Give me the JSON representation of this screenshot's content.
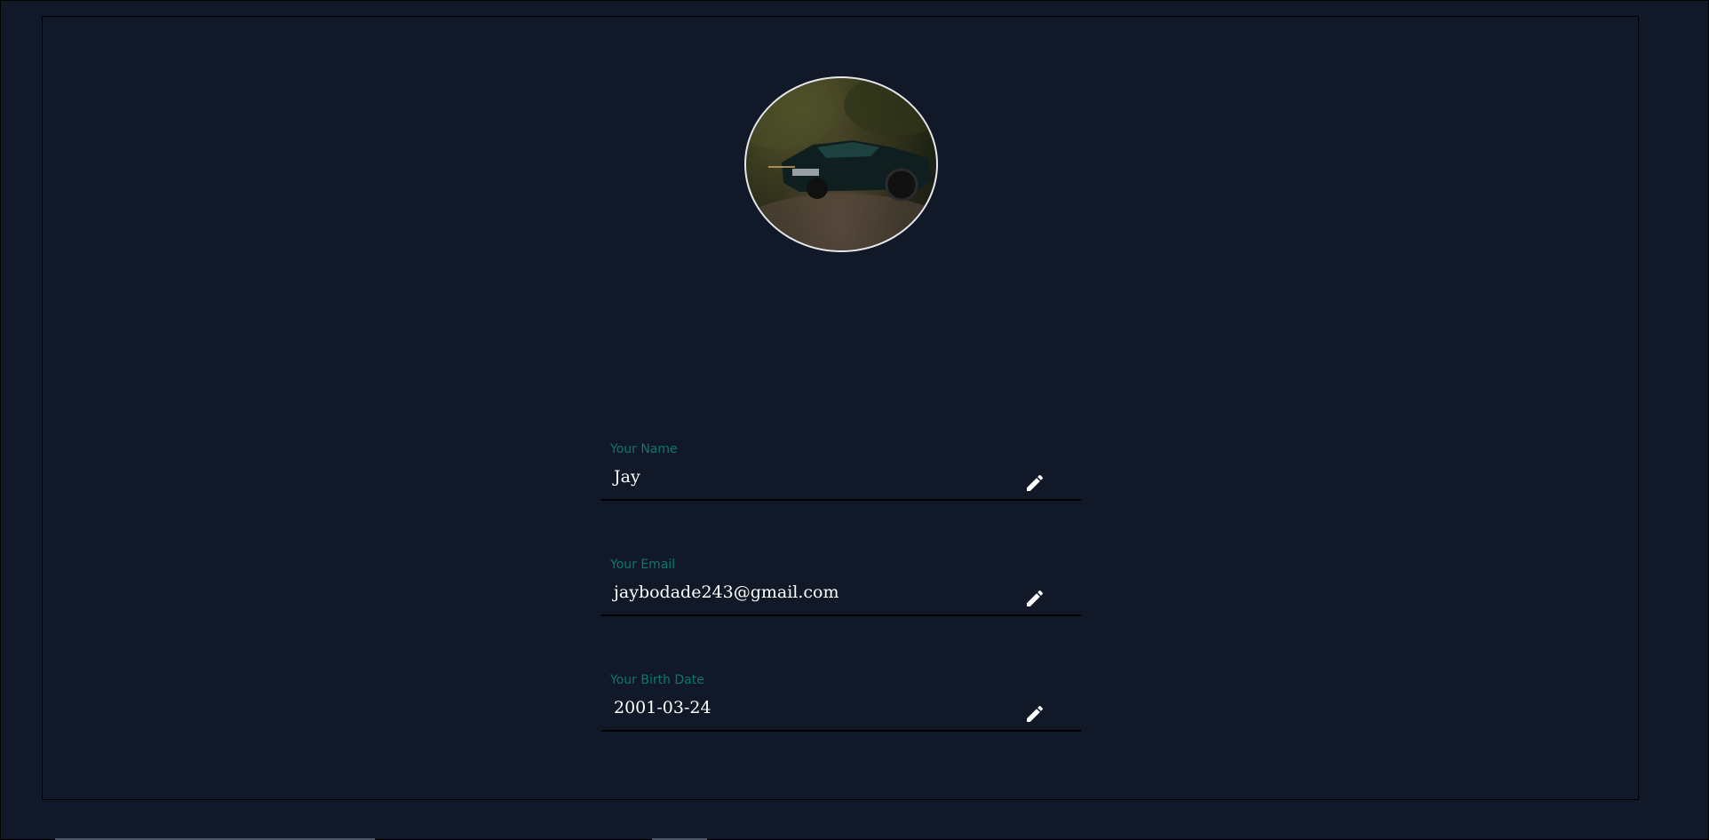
{
  "profile": {
    "avatar_alt": "profile photo",
    "fields": [
      {
        "label": "Your Name",
        "value": "Jay"
      },
      {
        "label": "Your Email",
        "value": "jaybodade243@gmail.com"
      },
      {
        "label": "Your Birth Date",
        "value": "2001-03-24"
      }
    ]
  },
  "icons": {
    "edit": "pencil-icon"
  },
  "colors": {
    "background": "#111827",
    "label": "#0f766e",
    "value": "#ffffff"
  }
}
